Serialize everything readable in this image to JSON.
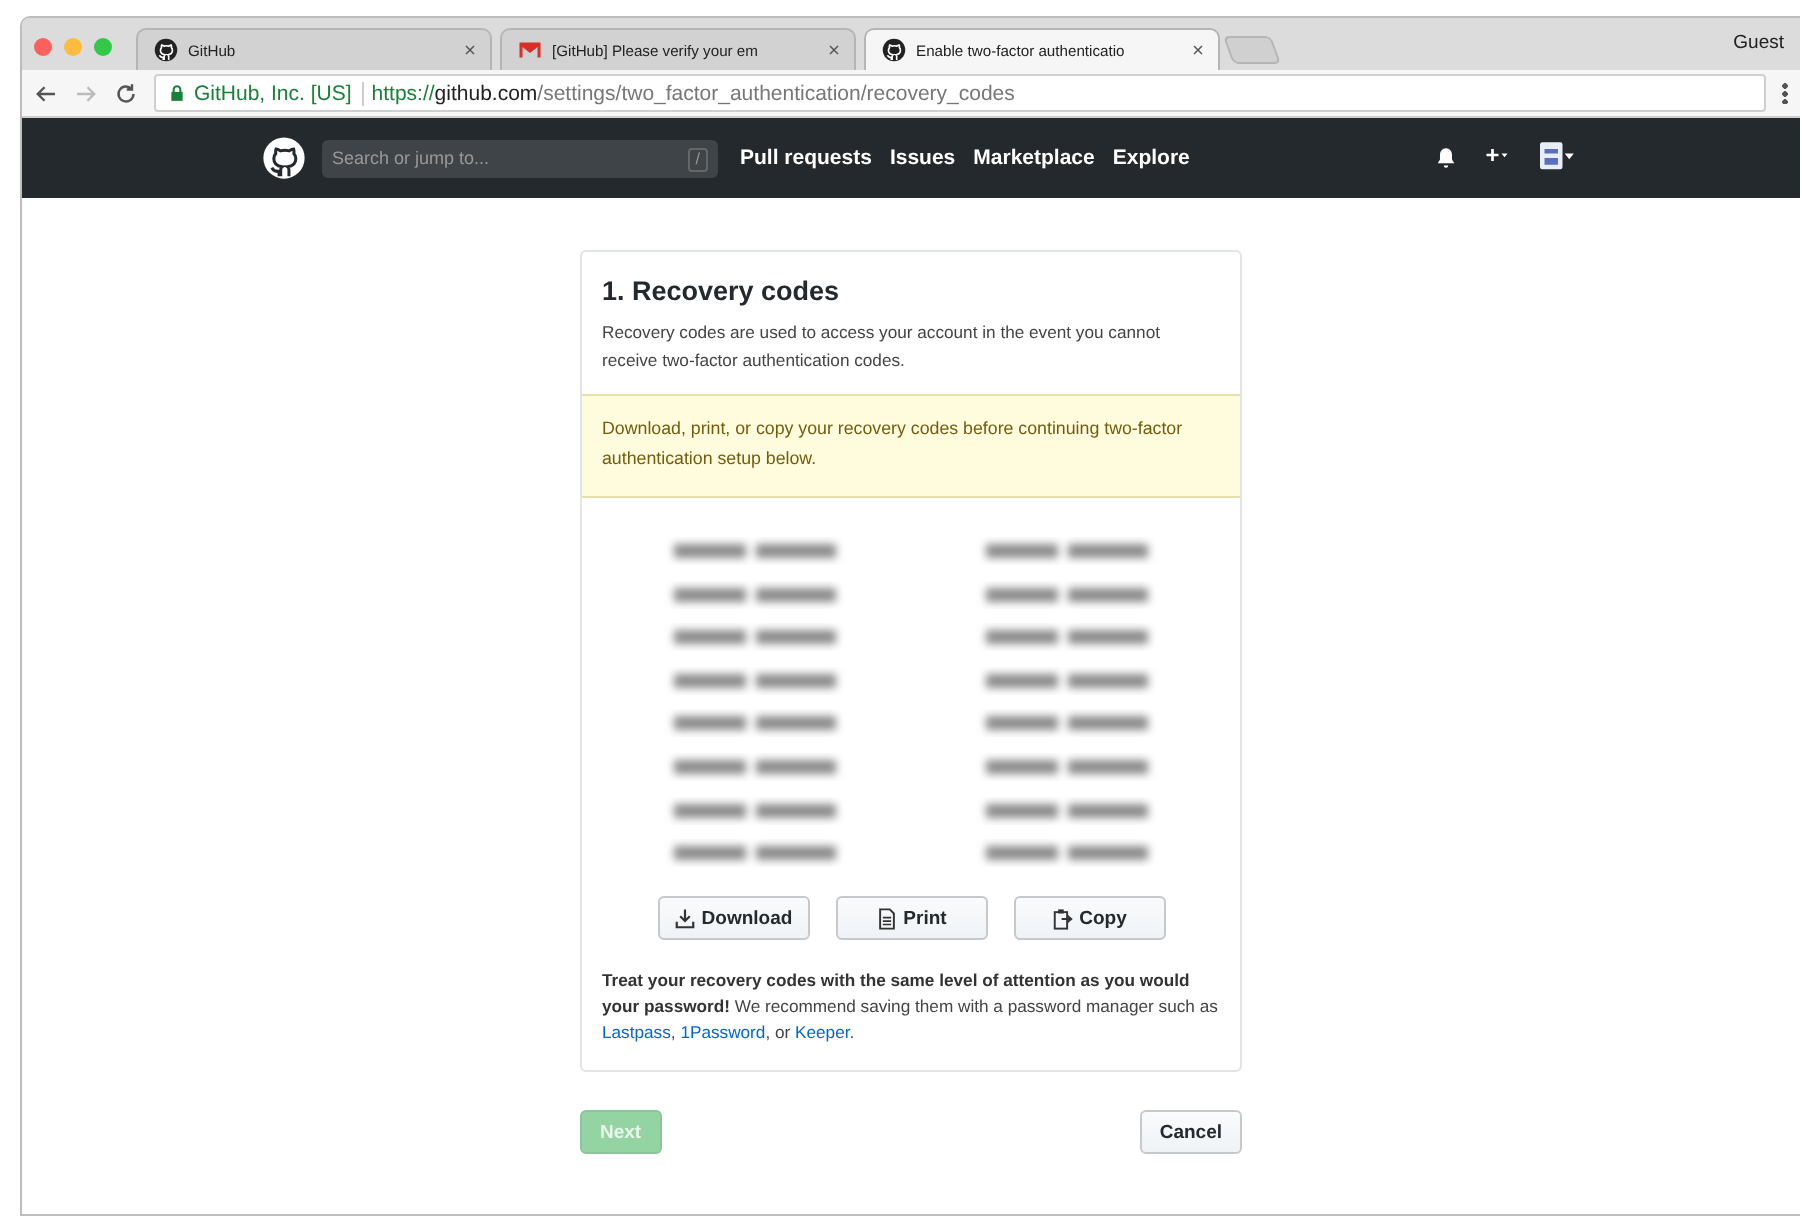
{
  "browser": {
    "tabs": [
      {
        "title": "GitHub",
        "selected": false
      },
      {
        "title": "[GitHub] Please verify your em",
        "selected": false
      },
      {
        "title": "Enable two-factor authenticatio",
        "selected": true
      }
    ],
    "profile": "Guest",
    "address": {
      "identity": "GitHub, Inc. [US]",
      "scheme": "https://",
      "host": "github.com",
      "path": "/settings/two_factor_authentication/recovery_codes"
    }
  },
  "header": {
    "search_placeholder": "Search or jump to...",
    "search_key": "/",
    "nav": [
      "Pull requests",
      "Issues",
      "Marketplace",
      "Explore"
    ]
  },
  "card": {
    "title": "1. Recovery codes",
    "description": "Recovery codes are used to access your account in the event you cannot receive two-factor authentication codes.",
    "warning": "Download, print, or copy your recovery codes before continuing two-factor authentication setup below.",
    "codes": [
      {
        "kind": "blurred"
      },
      {
        "kind": "blurred"
      },
      {
        "kind": "blurred"
      },
      {
        "kind": "blurred"
      },
      {
        "kind": "blurred"
      },
      {
        "kind": "blurred"
      },
      {
        "kind": "blurred"
      },
      {
        "kind": "blurred"
      },
      {
        "kind": "blurred"
      },
      {
        "kind": "blurred"
      },
      {
        "kind": "blurred"
      },
      {
        "kind": "blurred"
      },
      {
        "kind": "blurred"
      },
      {
        "kind": "blurred"
      },
      {
        "kind": "blurred"
      },
      {
        "kind": "blurred"
      }
    ],
    "buttons": [
      {
        "label": "Download"
      },
      {
        "label": "Print"
      },
      {
        "label": "Copy"
      }
    ],
    "note": {
      "lead": "Treat your recovery codes with the same level of attention as you would your password!",
      "text": " We recommend saving them with a password manager such as ",
      "links": [
        "Lastpass",
        "1Password",
        "Keeper"
      ],
      "sep1": ", ",
      "sep2": ", or ",
      "end": "."
    }
  },
  "actions": {
    "next": {
      "label": "Next",
      "disabled": true
    },
    "cancel": {
      "label": "Cancel"
    }
  }
}
